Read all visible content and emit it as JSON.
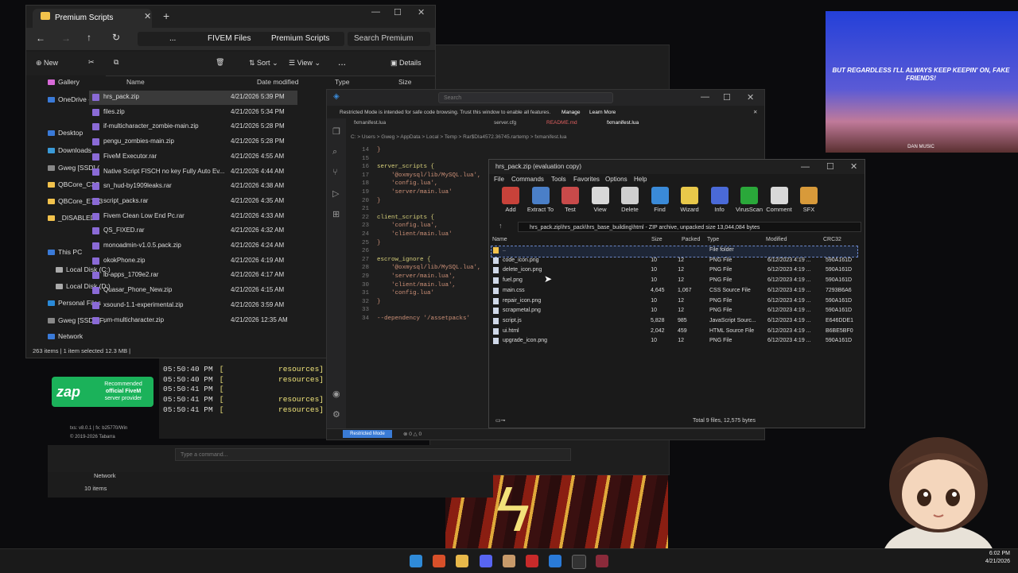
{
  "explorer": {
    "tab_title": "Premium Scripts",
    "breadcrumb": [
      "...",
      "FIVEM Files",
      "Premium Scripts"
    ],
    "search_placeholder": "Search Premium",
    "toolbar": {
      "new": "New",
      "sort": "Sort",
      "view": "View",
      "more": "...",
      "details": "Details"
    },
    "nav": [
      "Gallery",
      "OneDrive - Pers",
      "Desktop",
      "Downloads",
      "Gweg [SSD] (",
      "QBCore_C3C",
      "QBCore_E7A3",
      "_DISABLED",
      "This PC",
      "Local Disk (C:)",
      "Local Disk (D:)",
      "Personal Files",
      "Gweg [SSD] (F:",
      "Network"
    ],
    "columns": {
      "name": "Name",
      "date": "Date modified",
      "type": "Type",
      "size": "Size"
    },
    "files": [
      {
        "name": "hrs_pack.zip",
        "date": "4/21/2026 5:39 PM"
      },
      {
        "name": "files.zip",
        "date": "4/21/2026 5:34 PM"
      },
      {
        "name": "if-multicharacter_zombie-main.zip",
        "date": "4/21/2026 5:28 PM"
      },
      {
        "name": "pengu_zombies-main.zip",
        "date": "4/21/2026 5:28 PM"
      },
      {
        "name": "FiveM Executor.rar",
        "date": "4/21/2026 4:55 AM"
      },
      {
        "name": "Native Script FISCH no key Fully Auto Ev...",
        "date": "4/21/2026 4:44 AM"
      },
      {
        "name": "sn_hud-by1909leaks.rar",
        "date": "4/21/2026 4:38 AM"
      },
      {
        "name": "script_packs.rar",
        "date": "4/21/2026 4:35 AM"
      },
      {
        "name": "Fivem Clean Low End Pc.rar",
        "date": "4/21/2026 4:33 AM"
      },
      {
        "name": "QS_FIXED.rar",
        "date": "4/21/2026 4:32 AM"
      },
      {
        "name": "monoadmin-v1.0.5.pack.zip",
        "date": "4/21/2026 4:24 AM"
      },
      {
        "name": "okokPhone.zip",
        "date": "4/21/2026 4:19 AM"
      },
      {
        "name": "lb-apps_1709e2.rar",
        "date": "4/21/2026 4:17 AM"
      },
      {
        "name": "Quasar_Phone_New.zip",
        "date": "4/21/2026 4:15 AM"
      },
      {
        "name": "xsound-1.1-experimental.zip",
        "date": "4/21/2026 3:59 AM"
      },
      {
        "name": "um-multicharacter.zip",
        "date": "4/21/2026 12:35 AM"
      }
    ],
    "status": "263 items  |  1 item selected  12.3 MB  |"
  },
  "vscode": {
    "search": "Search",
    "banner": "Restricted Mode is intended for safe code browsing. Trust this window to enable all features.",
    "banner_manage": "Manage",
    "banner_learn": "Learn More",
    "tabs": [
      "fxmanifest.lua",
      "server.cfg",
      "README.md",
      "fxmanifest.lua"
    ],
    "breadcrumb": "C: > Users > Gweg > AppData > Local > Temp > Rar$DIa4572.36745.rartemp > fxmanifest.lua",
    "lines": [
      {
        "n": "14",
        "t": "}"
      },
      {
        "n": "15",
        "t": ""
      },
      {
        "n": "16",
        "t": "server_scripts {"
      },
      {
        "n": "17",
        "t": "    '@oxmysql/lib/MySQL.lua',"
      },
      {
        "n": "18",
        "t": "    'config.lua',"
      },
      {
        "n": "19",
        "t": "    'server/main.lua'"
      },
      {
        "n": "20",
        "t": "}"
      },
      {
        "n": "21",
        "t": ""
      },
      {
        "n": "22",
        "t": "client_scripts {"
      },
      {
        "n": "23",
        "t": "    'config.lua',"
      },
      {
        "n": "24",
        "t": "    'client/main.lua'"
      },
      {
        "n": "25",
        "t": "}"
      },
      {
        "n": "26",
        "t": ""
      },
      {
        "n": "27",
        "t": "escrow_ignore {"
      },
      {
        "n": "28",
        "t": "    '@oxmysql/lib/MySQL.lua',"
      },
      {
        "n": "29",
        "t": "    'server/main.lua',"
      },
      {
        "n": "30",
        "t": "    'client/main.lua',"
      },
      {
        "n": "31",
        "t": "    'config.lua'"
      },
      {
        "n": "32",
        "t": "}"
      },
      {
        "n": "33",
        "t": ""
      },
      {
        "n": "34",
        "t": "--dependency '/assetpacks'"
      }
    ],
    "status_mode": "Restricted Mode",
    "status_errors": "⊗ 0 △ 0"
  },
  "console": {
    "lines": [
      {
        "time": "05:50:40 PM",
        "word": "resources]"
      },
      {
        "time": "05:50:40 PM",
        "word": "resources]"
      },
      {
        "time": "05:50:41 PM",
        "word": ""
      },
      {
        "time": "05:50:41 PM",
        "word": "resources]"
      },
      {
        "time": "05:50:41 PM",
        "word": "resources]"
      }
    ],
    "type_placeholder": "Type a command..."
  },
  "zap": {
    "logo": "zap",
    "line1": "Recommended",
    "line2": "official FiveM",
    "line3": "server provider",
    "version": "txs: v8.0.1 | fx: b25770/Win",
    "copyright": "© 2019-2026 Tabarra"
  },
  "lower_explorer": {
    "network": "Network",
    "items": "10 items"
  },
  "winrar": {
    "title": "hrs_pack.zip (evaluation copy)",
    "menu": [
      "File",
      "Commands",
      "Tools",
      "Favorites",
      "Options",
      "Help"
    ],
    "tools": [
      {
        "label": "Add",
        "color": "#c8423a"
      },
      {
        "label": "Extract To",
        "color": "#4a7fc8"
      },
      {
        "label": "Test",
        "color": "#c84a4a"
      },
      {
        "label": "View",
        "color": "#d8d8d8"
      },
      {
        "label": "Delete",
        "color": "#cfcfcf"
      },
      {
        "label": "Find",
        "color": "#3a8ad8"
      },
      {
        "label": "Wizard",
        "color": "#e8c84a"
      },
      {
        "label": "Info",
        "color": "#4a6ad8"
      },
      {
        "label": "VirusScan",
        "color": "#2aa83a"
      },
      {
        "label": "Comment",
        "color": "#d8d8d8"
      },
      {
        "label": "SFX",
        "color": "#d89a3a"
      }
    ],
    "path": "hrs_pack.zip\\hrs_pack\\hrs_base_building\\html - ZIP archive, unpacked size 13,044,084 bytes",
    "columns": [
      "Name",
      "Size",
      "Packed",
      "Type",
      "Modified",
      "CRC32"
    ],
    "rows": [
      {
        "name": "..",
        "size": "",
        "packed": "",
        "type": "File folder",
        "mod": "",
        "crc": ""
      },
      {
        "name": "code_icon.png",
        "size": "10",
        "packed": "12",
        "type": "PNG File",
        "mod": "6/12/2023 4:19 ...",
        "crc": "590A161D"
      },
      {
        "name": "delete_icon.png",
        "size": "10",
        "packed": "12",
        "type": "PNG File",
        "mod": "6/12/2023 4:19 ...",
        "crc": "590A161D"
      },
      {
        "name": "fuel.png",
        "size": "10",
        "packed": "12",
        "type": "PNG File",
        "mod": "6/12/2023 4:19 ...",
        "crc": "590A161D"
      },
      {
        "name": "main.css",
        "size": "4,645",
        "packed": "1,067",
        "type": "CSS Source File",
        "mod": "6/12/2023 4:19 ...",
        "crc": "7293B6A6"
      },
      {
        "name": "repair_icon.png",
        "size": "10",
        "packed": "12",
        "type": "PNG File",
        "mod": "6/12/2023 4:19 ...",
        "crc": "590A161D"
      },
      {
        "name": "scrapmetal.png",
        "size": "10",
        "packed": "12",
        "type": "PNG File",
        "mod": "6/12/2023 4:19 ...",
        "crc": "590A161D"
      },
      {
        "name": "script.js",
        "size": "5,828",
        "packed": "985",
        "type": "JavaScript Sourc...",
        "mod": "6/12/2023 4:19 ...",
        "crc": "E646DDE1"
      },
      {
        "name": "ui.html",
        "size": "2,042",
        "packed": "459",
        "type": "HTML Source File",
        "mod": "6/12/2023 4:19 ...",
        "crc": "B6BE5BF0"
      },
      {
        "name": "upgrade_icon.png",
        "size": "10",
        "packed": "12",
        "type": "PNG File",
        "mod": "6/12/2023 4:19 ...",
        "crc": "590A161D"
      }
    ],
    "status": "Total 9 files, 12,575 bytes"
  },
  "media": {
    "lyric": "BUT REGARDLESS I'LL ALWAYS KEEP KEEPIN' ON, FAKE FRIENDS!",
    "credit": "DAN MUSIC"
  },
  "clock": {
    "time": "6:02 PM",
    "date": "4/21/2026"
  }
}
